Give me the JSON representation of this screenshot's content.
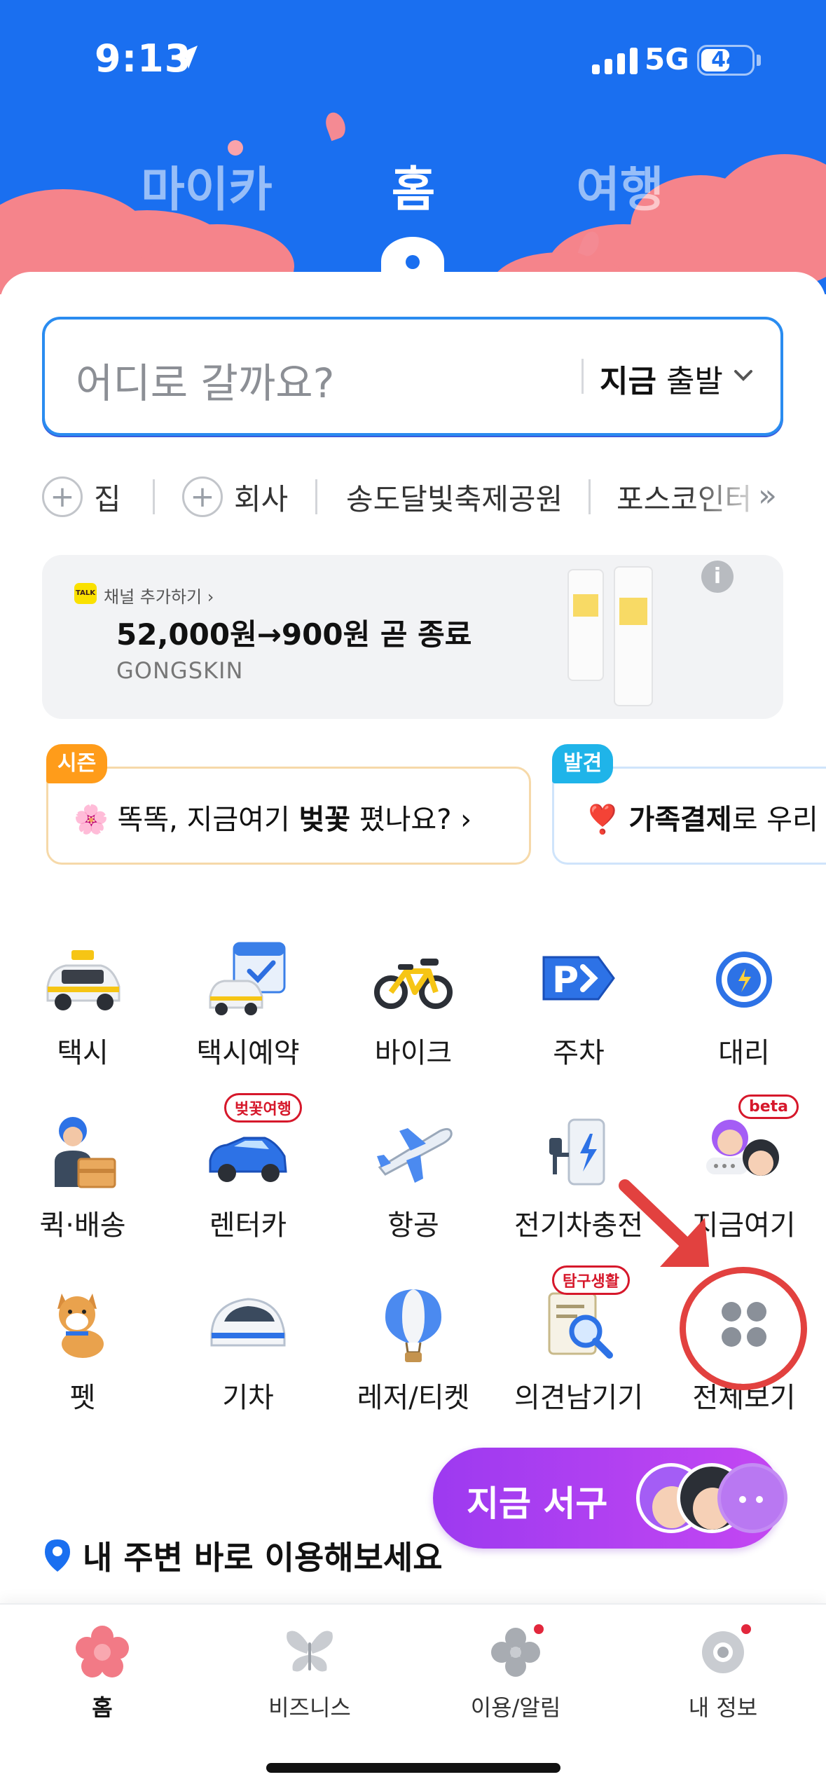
{
  "status_bar": {
    "time": "9:13",
    "network": "5G",
    "battery": "44"
  },
  "top_tabs": [
    {
      "label": "마이카",
      "active": false
    },
    {
      "label": "홈",
      "active": true
    },
    {
      "label": "여행",
      "active": false
    }
  ],
  "search": {
    "placeholder": "어디로 갈까요?",
    "depart_bold": "지금",
    "depart_rest": " 출발"
  },
  "quick_destinations": {
    "items": [
      "집",
      "회사",
      "송도달빛축제공원",
      "포스코인터"
    ],
    "more": "»"
  },
  "ad": {
    "channel_label": "채널 추가하기 ›",
    "talk_badge": "TALK",
    "title": "52,000원→900원 곧 종료",
    "brand": "GONGSKIN",
    "info": "i"
  },
  "promo_chips": [
    {
      "badge": "시즌",
      "emoji": "🌸",
      "text_pre": " 똑똑, 지금여기 ",
      "text_bold": "벚꽃",
      "text_post": " 폈나요? ›"
    },
    {
      "badge": "발견",
      "emoji": "❣️",
      "text_pre": " ",
      "text_bold": "가족결제",
      "text_post": "로 우리"
    }
  ],
  "services": [
    {
      "label": "택시",
      "icon": "taxi-icon"
    },
    {
      "label": "택시예약",
      "icon": "taxi-reservation-icon"
    },
    {
      "label": "바이크",
      "icon": "bike-icon"
    },
    {
      "label": "주차",
      "icon": "parking-icon"
    },
    {
      "label": "대리",
      "icon": "designated-driver-icon"
    },
    {
      "label": "퀵·배송",
      "icon": "delivery-icon"
    },
    {
      "label": "렌터카",
      "icon": "rental-car-icon",
      "badge": "벚꽃여행"
    },
    {
      "label": "항공",
      "icon": "airplane-icon"
    },
    {
      "label": "전기차충전",
      "icon": "ev-charging-icon"
    },
    {
      "label": "지금여기",
      "icon": "now-here-icon",
      "badge": "beta"
    },
    {
      "label": "펫",
      "icon": "pet-icon"
    },
    {
      "label": "기차",
      "icon": "train-icon"
    },
    {
      "label": "레저/티켓",
      "icon": "leisure-ticket-icon"
    },
    {
      "label": "의견남기기",
      "icon": "feedback-icon",
      "badge": "탐구생활"
    },
    {
      "label": "전체보기",
      "icon": "view-all-icon"
    }
  ],
  "floating_button": {
    "label": "지금 서구"
  },
  "nearby": {
    "title": "내 주변 바로 이용해보세요"
  },
  "bottom_nav": [
    {
      "label": "홈",
      "icon": "blossom-icon",
      "active": true,
      "dot": false
    },
    {
      "label": "비즈니스",
      "icon": "butterfly-icon",
      "active": false,
      "dot": false
    },
    {
      "label": "이용/알림",
      "icon": "clover-icon",
      "active": false,
      "dot": true
    },
    {
      "label": "내 정보",
      "icon": "flower-icon",
      "active": false,
      "dot": true
    }
  ],
  "colors": {
    "header_blue": "#1a6ff0",
    "blossom_pink": "#f5848b",
    "accent_purple": "#a13ff0",
    "annotation_red": "#e2413f"
  }
}
